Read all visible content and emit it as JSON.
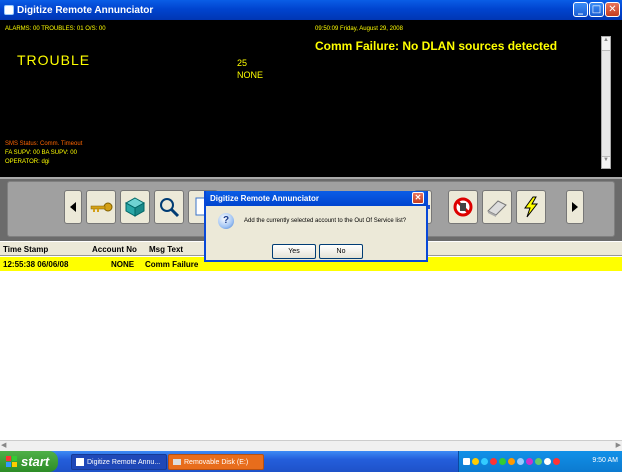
{
  "window": {
    "title": "Digitize Remote Annunciator",
    "min_icon": "minimize-icon",
    "max_icon": "maximize-icon",
    "close_icon": "close-icon"
  },
  "status": {
    "counts": "ALARMS: 00   TROUBLES: 01   O/S: 00",
    "datetime": "09:50:09 Friday, August 29, 2008",
    "message": "Comm Failure: No DLAN sources detected",
    "state": "TROUBLE",
    "account_num": "25",
    "account_name": "NONE",
    "sms_status": "SMS Status: Comm. Timeout",
    "supv": "FA SUPV: 00   BA SUPV: 00",
    "operator": "OPERATOR: dgi"
  },
  "toolbar": {
    "icons": [
      "left-arrow-icon",
      "key-icon",
      "box-icon",
      "search-icon",
      "page-icon",
      "blue-bar-icon",
      "no-entry-icon",
      "eraser-icon",
      "lightning-icon",
      "right-arrow-icon"
    ]
  },
  "table": {
    "headers": [
      "Time Stamp",
      "Account No",
      "Msg Text"
    ],
    "rows": [
      {
        "time": "12:55:38 06/06/08",
        "account": "NONE",
        "msg": "Comm Failure"
      }
    ]
  },
  "dialog": {
    "title": "Digitize Remote Annunciator",
    "message": "Add the currently selected account to the Out Of Service list?",
    "yes": "Yes",
    "no": "No"
  },
  "taskbar": {
    "start": "start",
    "task1": "Digitize Remote Annu...",
    "task2": "Removable Disk (E:)",
    "clock": "9:50 AM"
  },
  "colors": {
    "status_bg": "#000000",
    "status_text": "#ffff00",
    "sms_text": "#ff6600",
    "row_highlight": "#ffff00",
    "xp_blue": "#0044cf"
  }
}
